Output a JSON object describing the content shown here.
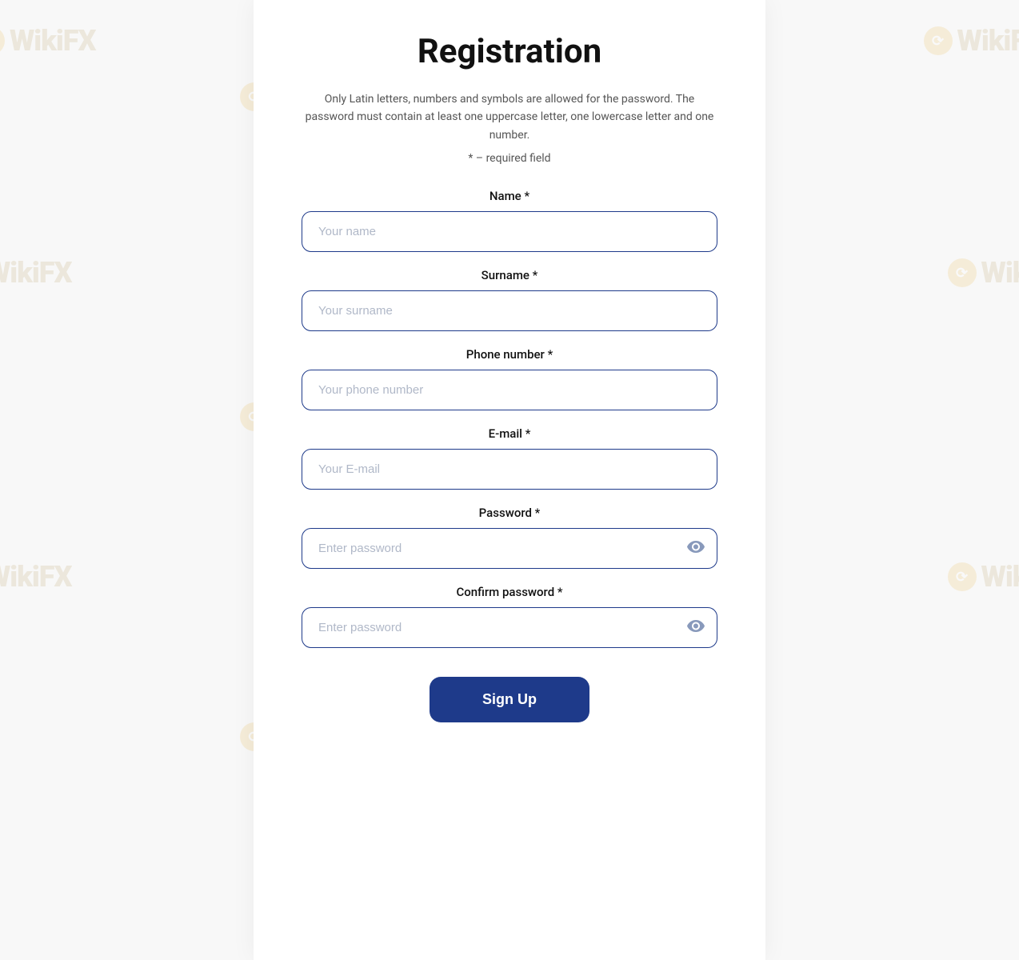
{
  "page": {
    "title": "Registration",
    "description": "Only Latin letters, numbers and symbols are allowed for the password. The password must contain at least one uppercase letter, one lowercase letter and one number.",
    "required_note": "* – required field"
  },
  "form": {
    "name_label": "Name *",
    "name_placeholder": "Your name",
    "surname_label": "Surname *",
    "surname_placeholder": "Your surname",
    "phone_label": "Phone number *",
    "phone_placeholder": "Your phone number",
    "email_label": "E-mail *",
    "email_placeholder": "Your E-mail",
    "password_label": "Password *",
    "password_placeholder": "Enter password",
    "confirm_password_label": "Confirm password *",
    "confirm_password_placeholder": "Enter password",
    "submit_label": "Sign Up"
  },
  "watermark": {
    "text": "WikiFX"
  }
}
